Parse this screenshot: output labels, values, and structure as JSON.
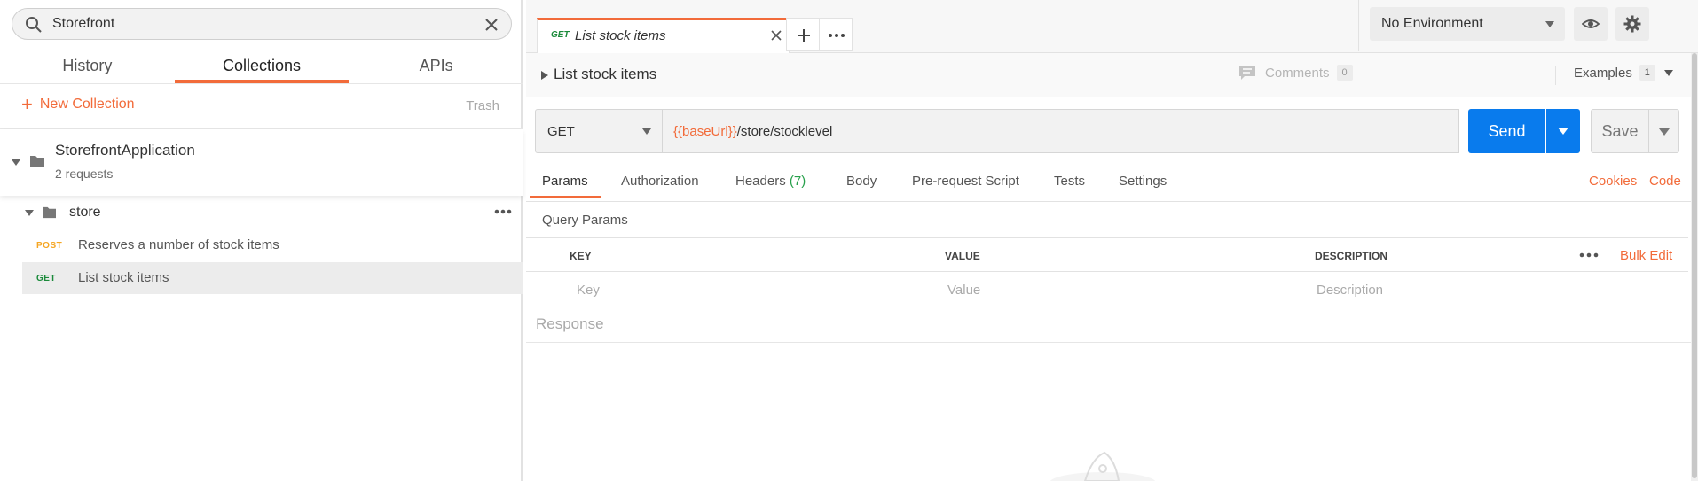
{
  "sidebar": {
    "search": {
      "value": "Storefront"
    },
    "tabs": [
      {
        "label": "History"
      },
      {
        "label": "Collections"
      },
      {
        "label": "APIs"
      }
    ],
    "new_collection_label": "New Collection",
    "trash_label": "Trash",
    "collection": {
      "name": "StorefrontApplication",
      "count": "2 requests"
    },
    "folder": {
      "name": "store"
    },
    "requests": [
      {
        "method": "POST",
        "label": "Reserves a number of stock items",
        "method_color": "#f5a623"
      },
      {
        "method": "GET",
        "label": "List stock items",
        "method_color": "#1a8a3a"
      }
    ]
  },
  "tabbar": {
    "active_tab": {
      "method": "GET",
      "title": "List stock items"
    }
  },
  "environment": {
    "selected": "No Environment"
  },
  "request": {
    "breadcrumb_title": "List stock items",
    "comments_label": "Comments",
    "comments_count": "0",
    "examples_label": "Examples",
    "examples_count": "1",
    "method": "GET",
    "url_variable": "{{baseUrl}}",
    "url_path": "/store/stocklevel",
    "send_label": "Send",
    "save_label": "Save",
    "tabs": {
      "params": "Params",
      "authorization": "Authorization",
      "headers": "Headers",
      "headers_count": "(7)",
      "body": "Body",
      "prerequest": "Pre-request Script",
      "tests": "Tests",
      "settings": "Settings"
    },
    "cookies_label": "Cookies",
    "code_label": "Code",
    "query_params_title": "Query Params",
    "table": {
      "headers": [
        "KEY",
        "VALUE",
        "DESCRIPTION"
      ],
      "placeholders": [
        "Key",
        "Value",
        "Description"
      ],
      "bulk_edit_label": "Bulk Edit"
    },
    "response_title": "Response"
  },
  "colors": {
    "accent": "#f26b3a",
    "send": "#097bed",
    "get": "#1a8a3a",
    "post": "#f5a623"
  }
}
